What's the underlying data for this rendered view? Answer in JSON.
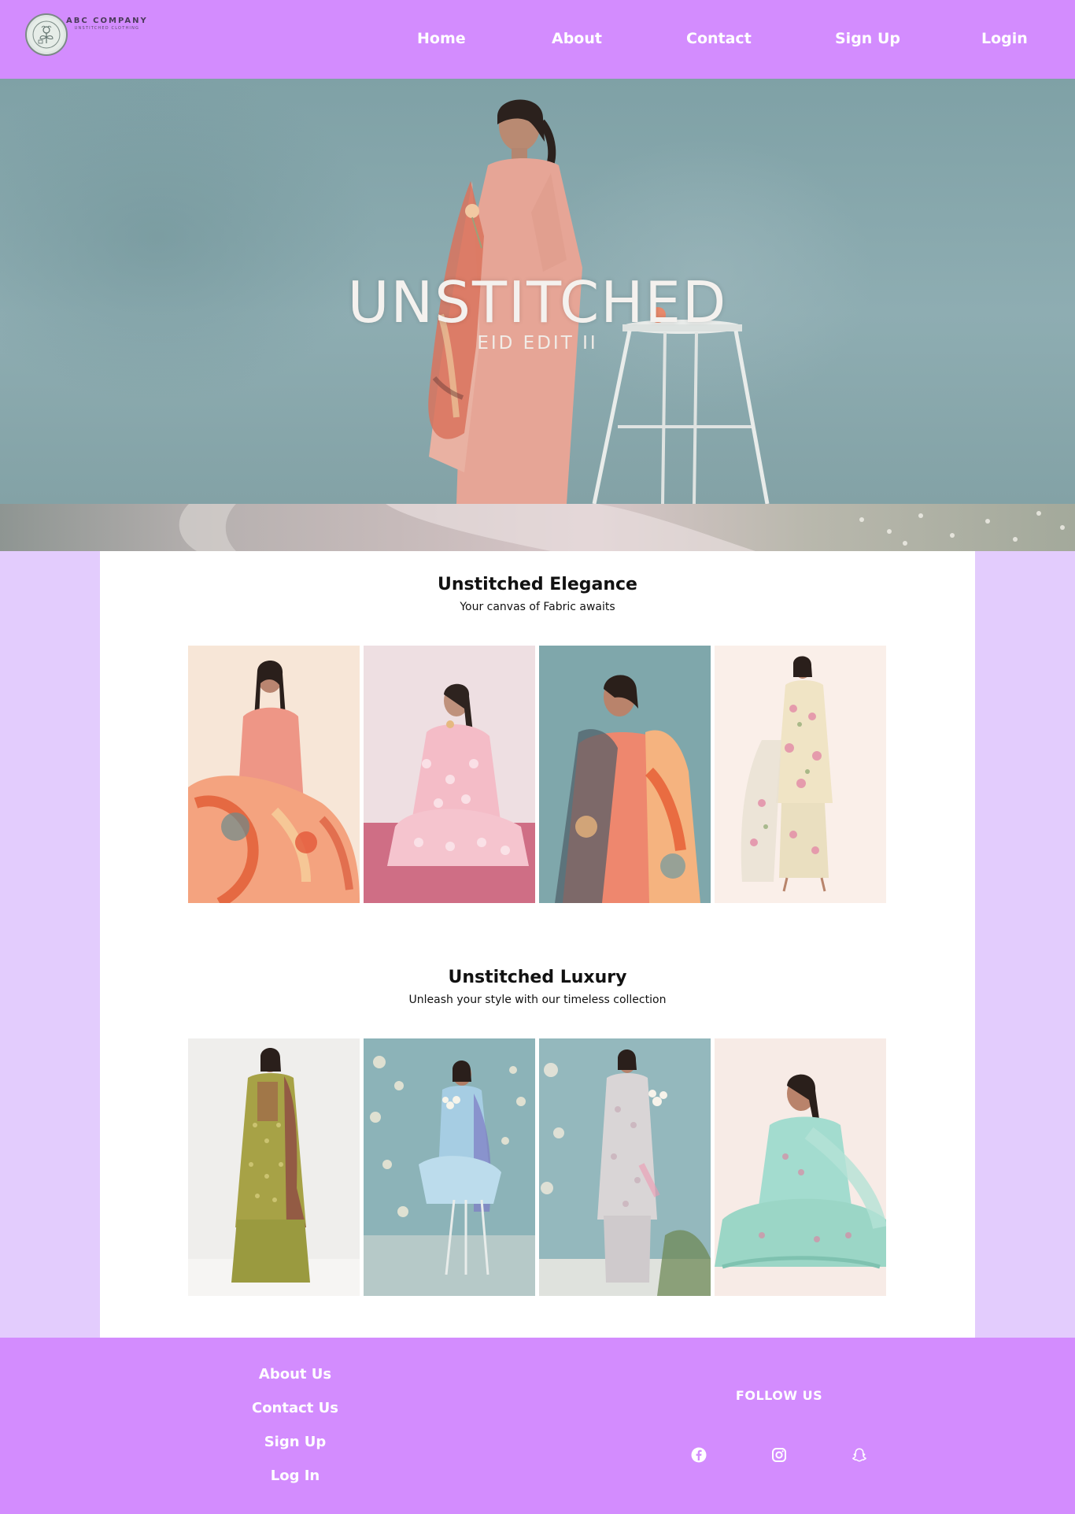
{
  "brand": {
    "name": "ABC COMPANY",
    "tagline": "UNSTITCHED CLOTHING"
  },
  "nav": {
    "items": [
      "Home",
      "About",
      "Contact",
      "Sign Up",
      "Login"
    ]
  },
  "hero": {
    "title": "UNSTITCHED",
    "subtitle": "EID EDIT II"
  },
  "sections": [
    {
      "title": "Unstitched Elegance",
      "subtitle": "Your canvas of Fabric awaits",
      "products": [
        {
          "image": "model-in-peach-embroidered-suit-with-floral-dupatta"
        },
        {
          "image": "model-seated-in-pink-polka-dot-suit"
        },
        {
          "image": "model-in-coral-suit-with-printed-dupatta"
        },
        {
          "image": "model-in-cream-floral-embroidered-suit"
        }
      ]
    },
    {
      "title": "Unstitched Luxury",
      "subtitle": "Unleash your style with our timeless collection",
      "products": [
        {
          "image": "model-in-olive-green-jacquard-suit"
        },
        {
          "image": "model-on-stool-in-blue-suit-with-flowers"
        },
        {
          "image": "model-in-grey-embroidered-suit-with-flowers"
        },
        {
          "image": "model-seated-in-mint-green-suit"
        }
      ]
    }
  ],
  "footer": {
    "links": [
      "About Us",
      "Contact Us",
      "Sign Up",
      "Log In"
    ],
    "follow_label": "FOLLOW US",
    "social_icons": [
      "facebook-icon",
      "instagram-icon",
      "snapchat-icon"
    ]
  },
  "colors": {
    "nav_bg": "#d38cfe",
    "page_bg": "#e3ccfd",
    "content_bg": "#ffffff",
    "text_light": "#ffffff"
  }
}
